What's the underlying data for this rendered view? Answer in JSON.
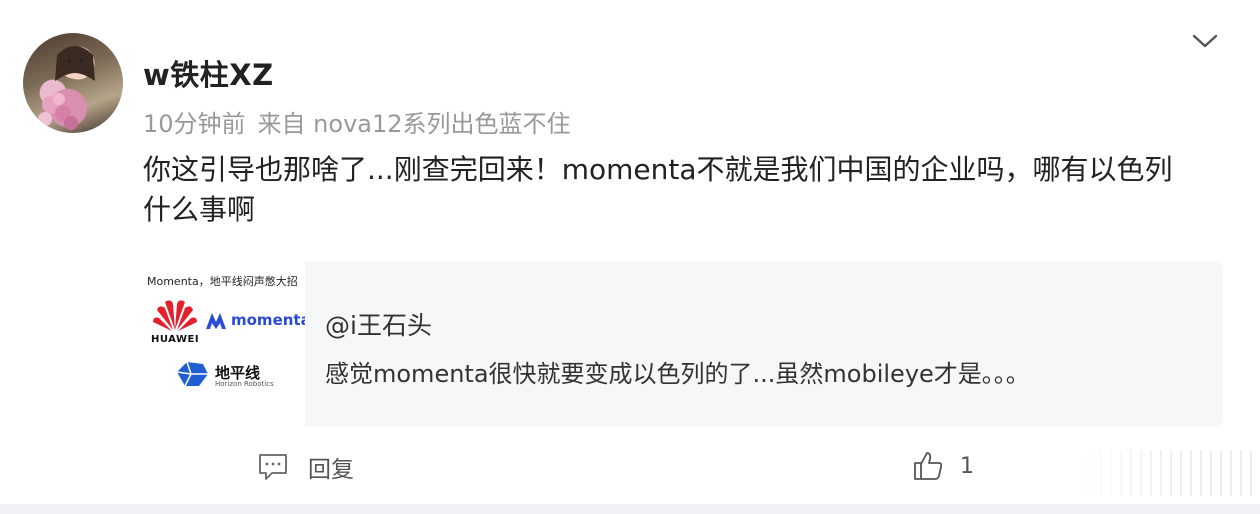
{
  "post": {
    "username": "w铁柱XZ",
    "time": "10分钟前",
    "source": "来自 nova12系列出色蓝不住",
    "content": "你这引导也那啥了...刚查完回来！momenta不就是我们中国的企业吗，哪有以色列什么事啊"
  },
  "quote": {
    "thumb_caption": "Momenta，地平线闷声憋大招",
    "thumb_logos": {
      "huawei": "HUAWEI",
      "momenta": "momenta",
      "horizon_cn": "地平线",
      "horizon_en": "Horizon Robotics"
    },
    "author": "@i王石头",
    "text": "感觉momenta很快就要变成以色列的了...虽然mobileye才是。。。"
  },
  "actions": {
    "reply_label": "回复",
    "like_count": "1"
  },
  "colors": {
    "huawei_red": "#e3202c",
    "momenta_blue": "#2a4ad9",
    "horizon_blue": "#1f5fd1",
    "meta_gray": "#999999"
  },
  "icons": [
    "chevron-down-icon",
    "comment-icon",
    "thumbs-up-icon"
  ]
}
